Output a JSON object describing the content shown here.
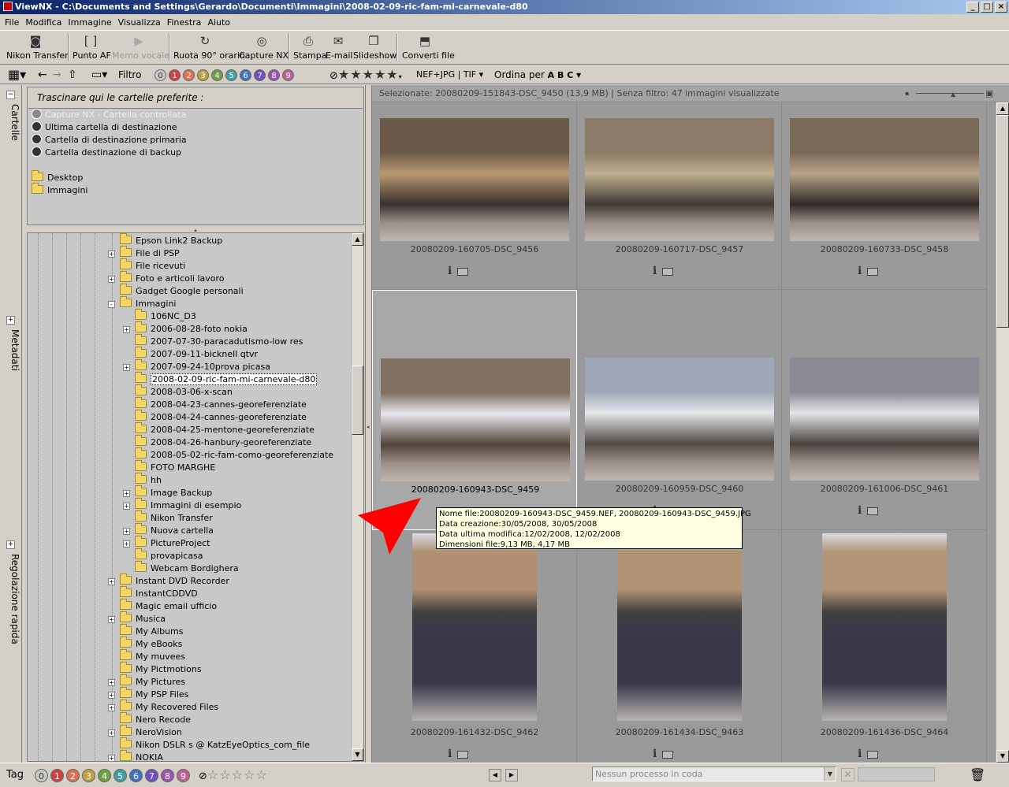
{
  "window": {
    "title": "ViewNX - C:\\Documents and Settings\\Gerardo\\Documenti\\Immagini\\2008-02-09-ric-fam-mi-carnevale-d80"
  },
  "menu": [
    "File",
    "Modifica",
    "Immagine",
    "Visualizza",
    "Finestra",
    "Aiuto"
  ],
  "toolbar": {
    "nikon_transfer": "Nikon Transfer",
    "punto_af": "Punto AF",
    "memo_vocale": "Memo vocale",
    "ruota": "Ruota 90° orario",
    "capture_nx": "Capture NX",
    "stampa": "Stampa",
    "email": "E-mail",
    "slideshow": "Slideshow",
    "converti": "Converti file"
  },
  "toolbar2": {
    "filtro": "Filtro",
    "labels": [
      "0",
      "1",
      "2",
      "3",
      "4",
      "5",
      "6",
      "7",
      "8",
      "9"
    ],
    "label_colors": [
      "#c8c8c8",
      "#d04040",
      "#e07050",
      "#c0a040",
      "#70a040",
      "#40a0a0",
      "#4070c0",
      "#7050c0",
      "#a050b0",
      "#c06090"
    ],
    "stars": "★★★★★",
    "format": "NEF+JPG | TIF",
    "ordina": "Ordina per",
    "ordina_icon": "A B C"
  },
  "sidetabs": [
    "Cartelle",
    "Metadati",
    "Regolazione rapida"
  ],
  "favorites": {
    "hint": "Trascinare qui le cartelle preferite :",
    "special": [
      "Capture NX - Cartella controllata",
      "Ultima cartella di destinazione",
      "Cartella di destinazione primaria",
      "Cartella destinazione di backup"
    ],
    "folders": [
      "Desktop",
      "Immagini"
    ]
  },
  "tree": [
    {
      "label": "Epson Link2 Backup",
      "level": 0,
      "exp": ""
    },
    {
      "label": "File di PSP",
      "level": 0,
      "exp": "+"
    },
    {
      "label": "File ricevuti",
      "level": 0,
      "exp": ""
    },
    {
      "label": "Foto e articoli lavoro",
      "level": 0,
      "exp": "+"
    },
    {
      "label": "Gadget Google personali",
      "level": 0,
      "exp": ""
    },
    {
      "label": "Immagini",
      "level": 0,
      "exp": "-"
    },
    {
      "label": "106NC_D3",
      "level": 1,
      "exp": ""
    },
    {
      "label": "2006-08-28-foto nokia",
      "level": 1,
      "exp": "+"
    },
    {
      "label": "2007-07-30-paracadutismo-low res",
      "level": 1,
      "exp": ""
    },
    {
      "label": "2007-09-11-bicknell qtvr",
      "level": 1,
      "exp": ""
    },
    {
      "label": "2007-09-24-10prova picasa",
      "level": 1,
      "exp": "+"
    },
    {
      "label": "2008-02-09-ric-fam-mi-carnevale-d80",
      "level": 1,
      "exp": "",
      "selected": true
    },
    {
      "label": "2008-03-06-x-scan",
      "level": 1,
      "exp": ""
    },
    {
      "label": "2008-04-23-cannes-georeferenziate",
      "level": 1,
      "exp": ""
    },
    {
      "label": "2008-04-24-cannes-georeferenziate",
      "level": 1,
      "exp": ""
    },
    {
      "label": "2008-04-25-mentone-georeferenziate",
      "level": 1,
      "exp": ""
    },
    {
      "label": "2008-04-26-hanbury-georeferenziate",
      "level": 1,
      "exp": ""
    },
    {
      "label": "2008-05-02-ric-fam-como-georeferenziate",
      "level": 1,
      "exp": ""
    },
    {
      "label": "FOTO MARGHE",
      "level": 1,
      "exp": ""
    },
    {
      "label": "hh",
      "level": 1,
      "exp": ""
    },
    {
      "label": "Image Backup",
      "level": 1,
      "exp": "+"
    },
    {
      "label": "Immagini di esempio",
      "level": 1,
      "exp": "+"
    },
    {
      "label": "Nikon Transfer",
      "level": 1,
      "exp": ""
    },
    {
      "label": "Nuova cartella",
      "level": 1,
      "exp": "+"
    },
    {
      "label": "PictureProject",
      "level": 1,
      "exp": "+"
    },
    {
      "label": "provapicasa",
      "level": 1,
      "exp": ""
    },
    {
      "label": "Webcam Bordighera",
      "level": 1,
      "exp": ""
    },
    {
      "label": "Instant DVD Recorder",
      "level": 0,
      "exp": "+"
    },
    {
      "label": "InstantCDDVD",
      "level": 0,
      "exp": ""
    },
    {
      "label": "Magic email ufficio",
      "level": 0,
      "exp": ""
    },
    {
      "label": "Musica",
      "level": 0,
      "exp": "+"
    },
    {
      "label": "My Albums",
      "level": 0,
      "exp": ""
    },
    {
      "label": "My eBooks",
      "level": 0,
      "exp": ""
    },
    {
      "label": "My muvees",
      "level": 0,
      "exp": ""
    },
    {
      "label": "My Pictmotions",
      "level": 0,
      "exp": ""
    },
    {
      "label": "My Pictures",
      "level": 0,
      "exp": "+"
    },
    {
      "label": "My PSP Files",
      "level": 0,
      "exp": "+"
    },
    {
      "label": "My Recovered Files",
      "level": 0,
      "exp": "+"
    },
    {
      "label": "Nero Recode",
      "level": 0,
      "exp": ""
    },
    {
      "label": "NeroVision",
      "level": 0,
      "exp": "+"
    },
    {
      "label": "Nikon DSLR s @ KatzEyeOptics_com_file",
      "level": 0,
      "exp": ""
    },
    {
      "label": "NOKIA",
      "level": 0,
      "exp": "+"
    }
  ],
  "status": "Selezionate: 20080209-151843-DSC_9450 (13,9 MB) | Senza filtro: 47 immagini visualizzate",
  "thumbs": [
    {
      "name": "20080209-160705-DSC_9456",
      "orient": "land",
      "palette": [
        "#6b5a4a",
        "#b89a70",
        "#3a3030"
      ]
    },
    {
      "name": "20080209-160717-DSC_9457",
      "orient": "land",
      "palette": [
        "#8a7a66",
        "#c0b090",
        "#403a36"
      ]
    },
    {
      "name": "20080209-160733-DSC_9458",
      "orient": "land",
      "palette": [
        "#7a6a58",
        "#b8a488",
        "#302a28"
      ]
    },
    {
      "name": "20080209-160943-DSC_9459",
      "orient": "land",
      "palette": [
        "#807060",
        "#e8e8ec",
        "#504438"
      ],
      "selected": true
    },
    {
      "name": "20080209-160959-DSC_9460",
      "orient": "land",
      "palette": [
        "#a0a8b8",
        "#e6e6ea",
        "#504a46"
      ]
    },
    {
      "name": "20080209-161006-DSC_9461",
      "orient": "land",
      "palette": [
        "#8a8a94",
        "#e4e4e8",
        "#4a4440"
      ]
    },
    {
      "name": "20080209-161432-DSC_9462",
      "orient": "port",
      "palette": [
        "#b09070",
        "#383848",
        "#303030"
      ]
    },
    {
      "name": "20080209-161434-DSC_9463",
      "orient": "port",
      "palette": [
        "#b09274",
        "#383848",
        "#303030"
      ]
    },
    {
      "name": "20080209-161436-DSC_9464",
      "orient": "port",
      "palette": [
        "#b29476",
        "#383848",
        "#303030"
      ]
    }
  ],
  "tooltip": [
    "Nome file:20080209-160943-DSC_9459.NEF, 20080209-160943-DSC_9459.JPG",
    "Data creazione:30/05/2008, 30/05/2008",
    "Data ultima modifica:12/02/2008, 12/02/2008",
    "Dimensioni file:9,13 MB, 4,17 MB"
  ],
  "bottom": {
    "tag": "Tag",
    "queue": "Nessun processo in coda"
  },
  "colors": {
    "title_start": "#0a246a",
    "title_end": "#a6caf0",
    "arrow": "#ff0000",
    "tooltip_bg": "#ffffe1"
  }
}
